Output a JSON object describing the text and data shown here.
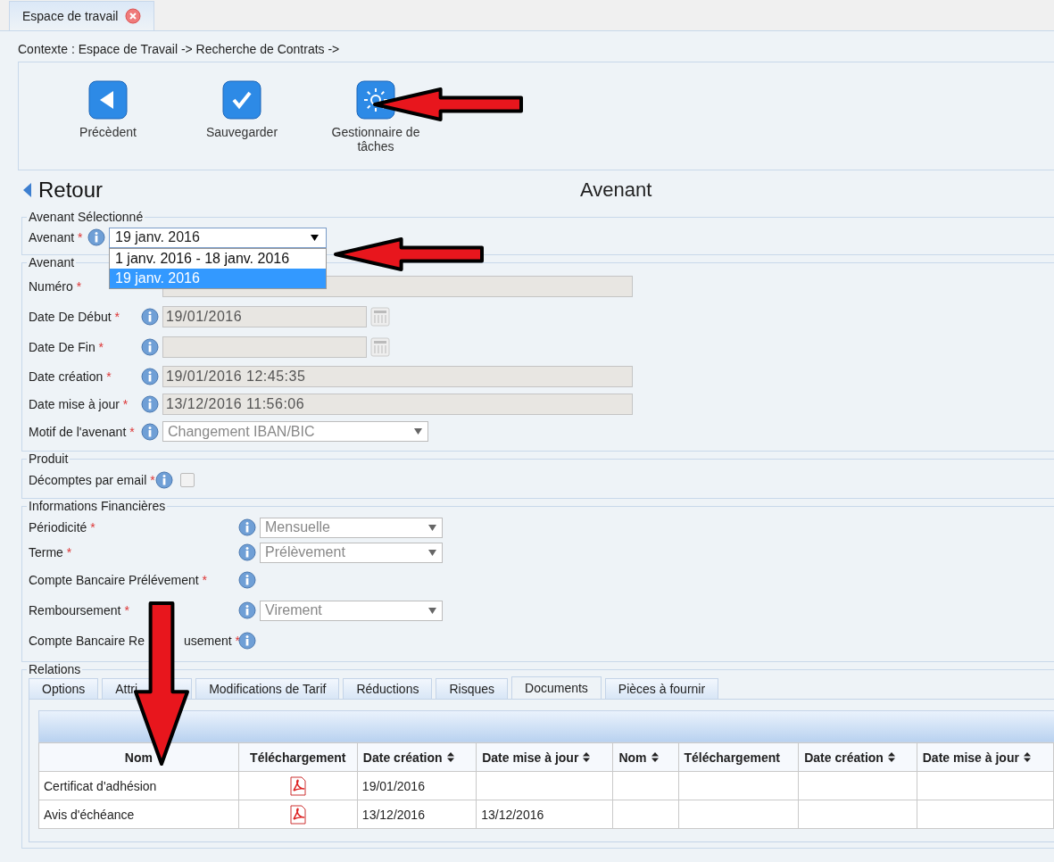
{
  "tab": {
    "label": "Espace de travail",
    "selected": true
  },
  "context": "Contexte : Espace de Travail -> Recherche de Contrats ->",
  "toolbar": [
    {
      "label": "Précèdent",
      "kind": "back"
    },
    {
      "label": "Sauvegarder",
      "kind": "check"
    },
    {
      "label": "Gestionnaire de tâches",
      "kind": "gear"
    }
  ],
  "back_link": "Retour",
  "title": "Avenant",
  "selected_section": {
    "legend": "Avenant Sélectionné",
    "label": "Avenant",
    "required": "*",
    "value": "19 janv. 2016",
    "options": [
      {
        "label": "1 janv. 2016 - 18 janv. 2016",
        "selected": false
      },
      {
        "label": "19 janv. 2016",
        "selected": true
      }
    ]
  },
  "avenant_section": {
    "legend": "Avenant",
    "fields": [
      {
        "label": "Numéro",
        "required": "*",
        "kind": "text",
        "info": false
      },
      {
        "label": "Date De Début",
        "required": "*",
        "kind": "date",
        "info": true,
        "value": "19/01/2016"
      },
      {
        "label": "Date De Fin",
        "required": "*",
        "kind": "date",
        "info": true
      },
      {
        "label": "Date création",
        "required": "*",
        "kind": "text",
        "info": true,
        "value": "19/01/2016 12:45:35"
      },
      {
        "label": "Date mise à jour",
        "required": "*",
        "kind": "text",
        "info": true,
        "value": "13/12/2016 11:56:06"
      },
      {
        "label": "Motif de l'avenant",
        "required": "*",
        "kind": "select",
        "info": true,
        "disabled": true,
        "value": "Changement IBAN/BIC"
      }
    ]
  },
  "produit_section": {
    "legend": "Produit",
    "label": "Décomptes par email",
    "required": "*",
    "checked": false
  },
  "finance_section": {
    "legend": "Informations Financières",
    "fields": [
      {
        "label": "Périodicité",
        "required": "*",
        "kind": "select",
        "disabled": true,
        "value": "Mensuelle"
      },
      {
        "label": "Terme",
        "required": "*",
        "kind": "select",
        "disabled": true,
        "value": "Prélèvement"
      },
      {
        "label": "Compte Bancaire Prélévement",
        "required": "*",
        "kind": "account"
      },
      {
        "label": "Remboursement",
        "required": "*",
        "kind": "select",
        "disabled": true,
        "value": "Virement"
      },
      {
        "label": "Compte Bancaire Re",
        "label_after": "usement",
        "required": "*",
        "kind": "account"
      }
    ]
  },
  "relations": {
    "legend": "Relations",
    "tabs": [
      {
        "label": "Options",
        "selected": false
      },
      {
        "label": "Attri",
        "selected": false
      },
      {
        "label": "Modifications de Tarif",
        "selected": false
      },
      {
        "label": "Réductions",
        "selected": false
      },
      {
        "label": "Risques",
        "selected": false
      },
      {
        "label": "Documents",
        "selected": true
      },
      {
        "label": "Pièces à fournir",
        "selected": false
      }
    ],
    "table": {
      "columns": [
        {
          "label": "Nom",
          "sortable": false
        },
        {
          "label": "Téléchargement",
          "sortable": false
        },
        {
          "label": "Date création",
          "sortable": true
        },
        {
          "label": "Date mise à jour",
          "sortable": true
        },
        {
          "label": "Nom",
          "sortable": true
        },
        {
          "label": "Téléchargement",
          "sortable": false
        },
        {
          "label": "Date création",
          "sortable": true
        },
        {
          "label": "Date mise à jour",
          "sortable": true
        }
      ],
      "rows": [
        {
          "name": "Certificat d'adhésion",
          "pdf": true,
          "created": "19/01/2016"
        },
        {
          "name": "Avis d'échéance",
          "pdf": true,
          "created": "13/12/2016",
          "updated": "13/12/2016"
        }
      ]
    }
  }
}
